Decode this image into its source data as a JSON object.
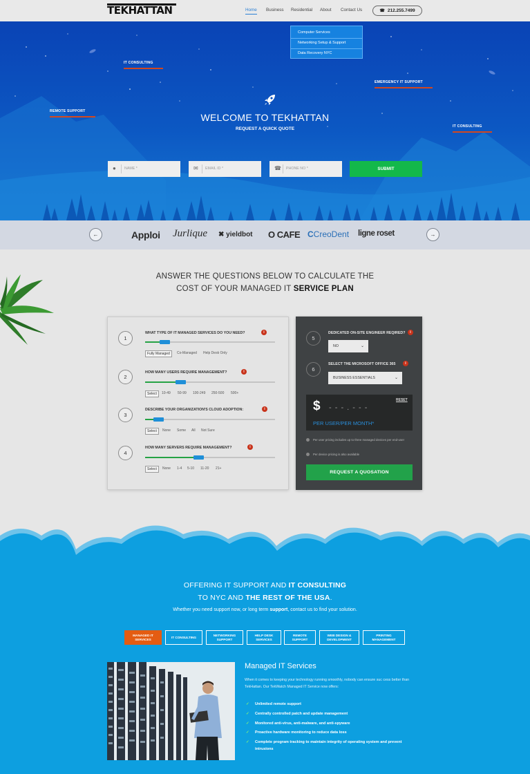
{
  "header": {
    "logo": "TEKHATTAN",
    "nav": [
      {
        "label": "Home",
        "active": true
      },
      {
        "label": "Business",
        "active": false
      },
      {
        "label": "Residential",
        "active": false
      },
      {
        "label": "About",
        "active": false
      },
      {
        "label": "Contact Us",
        "active": false
      }
    ],
    "phone": "212.255.7499",
    "dropdown": [
      "Computer Services",
      "Networking Setup & Support",
      "Data Recovery NYC"
    ]
  },
  "hero": {
    "tags": [
      "IT CONSULTING",
      "EMERGENCY IT SUPPORT",
      "REMOTE SUPPORT",
      "IT CONSULTING"
    ],
    "title": "WELCOME TO TEKHATTAN",
    "subtitle": "REQUEST A QUICK QUOTE",
    "fields": [
      {
        "placeholder": "NAME *",
        "icon": "user-icon"
      },
      {
        "placeholder": "EMAIL ID *",
        "icon": "envelope-icon"
      },
      {
        "placeholder": "PHONE NO *",
        "icon": "phone-icon"
      }
    ],
    "submit": "SUBMIT"
  },
  "clients": [
    "Apploi",
    "Jurlique",
    "yieldbot",
    "O CAFE",
    "CreoDent",
    "ligne roset"
  ],
  "calculator": {
    "title_line1": "ANSWER THE QUESTIONS BELOW TO CALCULATE THE",
    "title_line2_a": "COST OF YOUR MANAGED IT ",
    "title_line2_b": "SERVICE PLAN",
    "questions": [
      {
        "num": "1",
        "label": "WHAT TYPE OF IT MANAGED SERVICES DO YOU NEED?",
        "fill": 0.15,
        "options": [
          "Fully Managed",
          "Co-Managed",
          "Help Desk Only"
        ]
      },
      {
        "num": "2",
        "label": "HOW MANY USERS REQUIRE MANAGEMENT?",
        "fill": 0.27,
        "options": [
          "Select",
          "10-49",
          "50-99",
          "100-249",
          "250-500",
          "500+"
        ]
      },
      {
        "num": "3",
        "label": "DESCRIBE YOUR ORGANIZATION'S CLOUD ADOPTION:",
        "fill": 0.1,
        "options": [
          "Select",
          "None",
          "Some",
          "All",
          "Not Sure"
        ]
      },
      {
        "num": "4",
        "label": "HOW MANY SERVERS REQUIRE MANAGEMENT?",
        "fill": 0.41,
        "options": [
          "Select",
          "None",
          "1-4",
          "5-10",
          "11-20",
          "21+"
        ]
      }
    ],
    "q5": {
      "num": "5",
      "label": "DEDICATED ON-SITE ENGINEER REQIRED?",
      "value": "NO"
    },
    "q6": {
      "num": "6",
      "label": "SELECT THE MICROSOFT OFFICE 365",
      "value": "BUSINESS ESSENTIALS"
    },
    "price": {
      "currency": "$",
      "placeholder": "- - - . - - -",
      "reset": "RESET",
      "unit": "PER USER/PER MONTH*"
    },
    "notes": [
      "Per user pricing includes up to three managed devices per end-user",
      "Per device pricing is also available"
    ],
    "quote_button": "REQUEST A  QUOSATION"
  },
  "offer": {
    "line1_a": "OFFERING IT SUPPORT AND ",
    "line1_b": "IT CONSULTING",
    "line2_a": "TO NYC AND ",
    "line2_b": "THE REST OF THE USA",
    "line2_c": ".",
    "line3_a": "Whether you need support now, or long term ",
    "line3_b": "support",
    "line3_c": ", contact us to find your solution.",
    "tabs": [
      {
        "l1": "MANAGED IT",
        "l2": "SERVICES"
      },
      {
        "l1": "IT CONSULTING",
        "l2": ""
      },
      {
        "l1": "NETWORKING",
        "l2": "SUPPORT"
      },
      {
        "l1": "HELP DESK",
        "l2": "SERVICES"
      },
      {
        "l1": "REMOTE",
        "l2": "SUPPORT"
      },
      {
        "l1": "WEB DESIGN &",
        "l2": "DEVELOPMENT"
      },
      {
        "l1": "PRINTING",
        "l2": "MANAGEMENT"
      }
    ],
    "section_title": "Managed IT Services",
    "description": "When it comes to keeping your technology running smoothly, nobody can ensure suc cess better than TekHattan. Our TekWatch Managed IT Service now offers:",
    "bullets": [
      "Unlimited remote support",
      "Centrally controlled patch and update management",
      "Monitored anti-virus, anti-malware, and anti-spyware",
      "Proactive hardware monitoring to reduce data loss",
      "Complete program tracking to maintain integrity of operating system and prevent intrusions"
    ]
  },
  "colors": {
    "accent_blue": "#0a43b5",
    "submit_green": "#13b84a",
    "tag_underline": "#d4481e",
    "section_blue": "#0d9fe0",
    "active_tab": "#e45c12"
  }
}
